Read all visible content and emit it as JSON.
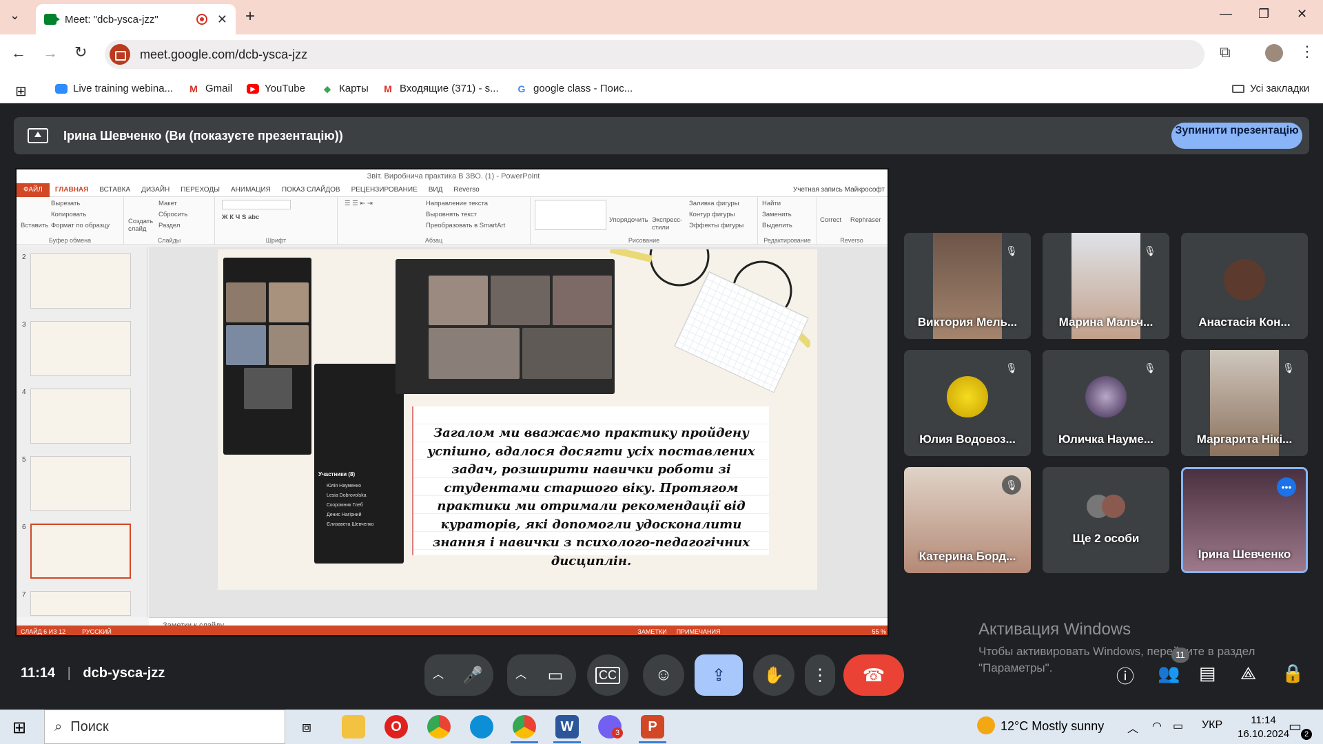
{
  "browser": {
    "tab_title": "Meet: \"dcb-ysca-jzz\"",
    "new_tab": "+",
    "url": "meet.google.com/dcb-ysca-jzz",
    "bookmarks": [
      "Live training webina...",
      "Gmail",
      "YouTube",
      "Карты",
      "Входящие (371) - s...",
      "google class - Поис..."
    ],
    "all_bookmarks": "Усі закладки"
  },
  "meet": {
    "presenting_banner": "Ірина Шевченко (Ви (показуєте презентацію))",
    "stop_presenting": "Зупинити презентацію",
    "time": "11:14",
    "separator": "|",
    "meeting_code": "dcb-ysca-jzz",
    "people_count": "11"
  },
  "ppt": {
    "window_title": "Звіт. Виробнича практика В ЗВО. (1) - PowerPoint",
    "tabs": [
      "ФАЙЛ",
      "ГЛАВНАЯ",
      "ВСТАВКА",
      "ДИЗАЙН",
      "ПЕРЕХОДЫ",
      "АНИМАЦИЯ",
      "ПОКАЗ СЛАЙДОВ",
      "РЕЦЕНЗИРОВАНИЕ",
      "ВИД",
      "Reverso"
    ],
    "account": "Учетная запись Майкрософт",
    "ribbon": {
      "paste": "Вставить",
      "cut": "Вырезать",
      "copy": "Копировать",
      "format": "Формат по образцу",
      "clipboard": "Буфер обмена",
      "new_slide": "Создать слайд",
      "layout": "Макет",
      "reset": "Сбросить",
      "section": "Раздел",
      "slides": "Слайды",
      "font": "Шрифт",
      "text_direction": "Направление текста",
      "align_text": "Выровнять текст",
      "smartart": "Преобразовать в SmartArt",
      "paragraph": "Абзац",
      "arrange": "Упорядочить",
      "quick_styles": "Экспресс-стили",
      "shape_fill": "Заливка фигуры",
      "shape_outline": "Контур фигуры",
      "shape_effects": "Эффекты фигуры",
      "drawing": "Рисование",
      "find": "Найти",
      "replace": "Заменить",
      "select": "Выделить",
      "editing": "Редактирование",
      "correct": "Correct",
      "rephraser": "Rephraser",
      "reverso": "Reverso"
    },
    "slide_numbers": [
      "2",
      "3",
      "4",
      "5",
      "6",
      "7"
    ],
    "slide_text": "Загалом ми вважаємо практику пройдену успішно, вдалося досягти усіх поставлених задач, розширити навички роботи зі студентами старшого віку. Протягом практики ми отримали рекомендації від кураторів, які допомогли удосконалити знання і навички з психолого-педагогічних дисциплін.",
    "phone_participants_title": "Участники (8)",
    "phone_participants": [
      "Юлія Науменко",
      "Lesia Dobrovolska",
      "Скоромник Глеб",
      "Денис Нагірний",
      "Єлизавета Шевченко"
    ],
    "notes": "Заметки к слайду",
    "status_slide": "СЛАЙД 6 ИЗ 12",
    "status_lang": "РУССКИЙ",
    "status_notes": "ЗАМЕТКИ",
    "status_comments": "ПРИМЕЧАНИЯ",
    "zoom": "55 %"
  },
  "participants": [
    {
      "name": "Виктория Мель...",
      "muted": true,
      "color": "#8a6a55"
    },
    {
      "name": "Марина Мальч...",
      "muted": true,
      "color": "#b99a86"
    },
    {
      "name": "Анастасія Кон...",
      "muted": false,
      "color": "#5c3a2e"
    },
    {
      "name": "Юлия Водовоз...",
      "muted": true,
      "color": "#e8c400"
    },
    {
      "name": "Юличка Науме...",
      "muted": true,
      "color": "#6a5070"
    },
    {
      "name": "Маргарита Нікі...",
      "muted": true,
      "color": "#a08770"
    },
    {
      "name": "Катерина Борд...",
      "muted": true,
      "color": "#c49a86"
    },
    {
      "name": "Ще 2 особи",
      "muted": false,
      "color": "#555"
    },
    {
      "name": "Ірина Шевченко",
      "muted": false,
      "color": "#7a5c6c"
    }
  ],
  "windows": {
    "activation_title": "Активация Windows",
    "activation_text_1": "Чтобы активировать Windows, перейдите в раздел",
    "activation_text_2": "\"Параметры\".",
    "search": "Поиск",
    "weather": "12°C  Mostly sunny",
    "lang": "УКР",
    "time": "11:14",
    "date": "16.10.2024",
    "notif_count": "2",
    "viber_badge": "3"
  }
}
